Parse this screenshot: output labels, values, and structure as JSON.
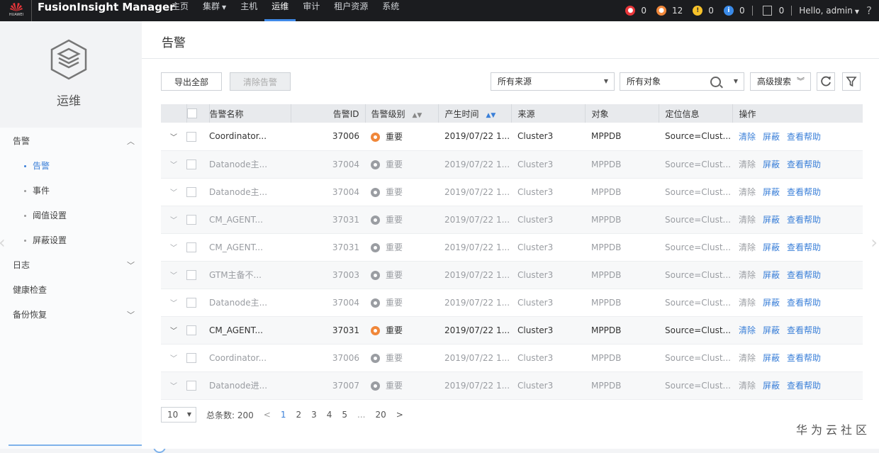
{
  "topbar": {
    "logo_text": "HUAWEI",
    "brand": "FusionInsight Manager",
    "nav": [
      {
        "label": "主页",
        "dropdown": false
      },
      {
        "label": "集群",
        "dropdown": true
      },
      {
        "label": "主机",
        "dropdown": false
      },
      {
        "label": "运维",
        "dropdown": false,
        "active": true
      },
      {
        "label": "审计",
        "dropdown": false
      },
      {
        "label": "租户资源",
        "dropdown": false
      },
      {
        "label": "系统",
        "dropdown": false
      }
    ],
    "alarm_counts": {
      "critical": "0",
      "major": "12",
      "minor": "0",
      "warning": "0",
      "tasks": "0"
    },
    "colors": {
      "critical": "#e8363a",
      "major": "#f0873a",
      "minor": "#f7c22a",
      "warning": "#3a8ae8"
    },
    "user": "Hello, admin",
    "help": "?"
  },
  "sidebar": {
    "title": "运维",
    "menu": [
      {
        "label": "告警",
        "chevron": "up"
      },
      {
        "label": "告警",
        "sub": true,
        "active": true
      },
      {
        "label": "事件",
        "sub": true
      },
      {
        "label": "阈值设置",
        "sub": true
      },
      {
        "label": "屏蔽设置",
        "sub": true
      },
      {
        "label": "日志",
        "chevron": "down"
      },
      {
        "label": "健康检查"
      },
      {
        "label": "备份恢复",
        "chevron": "down"
      }
    ]
  },
  "main": {
    "title": "告警",
    "toolbar": {
      "export_label": "导出全部",
      "clear_label": "清除告警",
      "source_select": "所有来源",
      "object_placeholder": "所有对象",
      "advanced_label": "高级搜索"
    },
    "table": {
      "headers": [
        "告警名称",
        "告警ID",
        "告警级别",
        "产生时间",
        "来源",
        "对象",
        "定位信息",
        "操作"
      ],
      "rows": [
        {
          "name": "Coordinator...",
          "id": "37006",
          "level": "重要",
          "time": "2019/07/22 1...",
          "source": "Cluster3",
          "object": "MPPDB",
          "location": "Source=Clust...",
          "highlight": true
        },
        {
          "name": "Datanode主...",
          "id": "37004",
          "level": "重要",
          "time": "2019/07/22 1...",
          "source": "Cluster3",
          "object": "MPPDB",
          "location": "Source=Clust...",
          "highlight": false
        },
        {
          "name": "Datanode主...",
          "id": "37004",
          "level": "重要",
          "time": "2019/07/22 1...",
          "source": "Cluster3",
          "object": "MPPDB",
          "location": "Source=Clust...",
          "highlight": false
        },
        {
          "name": "CM_AGENT...",
          "id": "37031",
          "level": "重要",
          "time": "2019/07/22 1...",
          "source": "Cluster3",
          "object": "MPPDB",
          "location": "Source=Clust...",
          "highlight": false
        },
        {
          "name": "CM_AGENT...",
          "id": "37031",
          "level": "重要",
          "time": "2019/07/22 1...",
          "source": "Cluster3",
          "object": "MPPDB",
          "location": "Source=Clust...",
          "highlight": false
        },
        {
          "name": "GTM主备不...",
          "id": "37003",
          "level": "重要",
          "time": "2019/07/22 1...",
          "source": "Cluster3",
          "object": "MPPDB",
          "location": "Source=Clust...",
          "highlight": false
        },
        {
          "name": "Datanode主...",
          "id": "37004",
          "level": "重要",
          "time": "2019/07/22 1...",
          "source": "Cluster3",
          "object": "MPPDB",
          "location": "Source=Clust...",
          "highlight": false
        },
        {
          "name": "CM_AGENT...",
          "id": "37031",
          "level": "重要",
          "time": "2019/07/22 1...",
          "source": "Cluster3",
          "object": "MPPDB",
          "location": "Source=Clust...",
          "highlight": true
        },
        {
          "name": "Coordinator...",
          "id": "37006",
          "level": "重要",
          "time": "2019/07/22 1...",
          "source": "Cluster3",
          "object": "MPPDB",
          "location": "Source=Clust...",
          "highlight": false
        },
        {
          "name": "Datanode进...",
          "id": "37007",
          "level": "重要",
          "time": "2019/07/22 1...",
          "source": "Cluster3",
          "object": "MPPDB",
          "location": "Source=Clust...",
          "highlight": false
        }
      ],
      "actions": {
        "clear": "清除",
        "mask": "屏蔽",
        "help": "查看帮助"
      }
    },
    "pager": {
      "page_size": "10",
      "total": "总条数: 200",
      "pages": [
        "1",
        "2",
        "3",
        "4",
        "5"
      ],
      "ellipsis": "...",
      "last": "20",
      "current": "1"
    }
  },
  "watermark": "华为云社区"
}
